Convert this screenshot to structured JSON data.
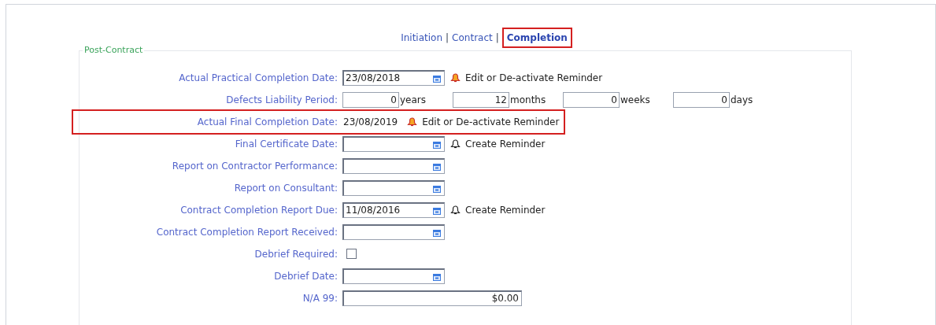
{
  "tabs": [
    {
      "label": "Initiation",
      "selected": false
    },
    {
      "label": "Contract",
      "selected": false
    },
    {
      "label": "Completion",
      "selected": true
    }
  ],
  "tab_separators": [
    "|",
    "|"
  ],
  "section": {
    "title": "Post-Contract",
    "rows": [
      {
        "kind": "date",
        "label": "Actual Practical Completion Date:",
        "value": "23/08/2018",
        "highlighted": false,
        "reminder": {
          "active": true,
          "text": "Edit or De-activate Reminder"
        }
      },
      {
        "kind": "period",
        "label": "Defects Liability Period:",
        "highlighted": false,
        "parts": [
          {
            "value": "0",
            "unit": "years"
          },
          {
            "value": "12",
            "unit": "months"
          },
          {
            "value": "0",
            "unit": "weeks"
          },
          {
            "value": "0",
            "unit": "days"
          }
        ]
      },
      {
        "kind": "text",
        "label": "Actual Final Completion Date:",
        "value": "23/08/2019",
        "highlighted": true,
        "reminder": {
          "active": true,
          "text": "Edit or De-activate Reminder"
        }
      },
      {
        "kind": "date",
        "label": "Final Certificate Date:",
        "highlighted": false,
        "reminder": {
          "active": false,
          "text": "Create Reminder"
        }
      },
      {
        "kind": "date",
        "label": "Report on Contractor Performance:",
        "highlighted": false
      },
      {
        "kind": "date",
        "label": "Report on Consultant:",
        "highlighted": false
      },
      {
        "kind": "date",
        "label": "Contract Completion Report Due:",
        "value": "11/08/2016",
        "highlighted": false,
        "reminder": {
          "active": false,
          "text": "Create Reminder"
        }
      },
      {
        "kind": "date",
        "label": "Contract Completion Report Received:",
        "highlighted": false
      },
      {
        "kind": "checkbox",
        "label": "Debrief Required:",
        "checked": false,
        "highlighted": false
      },
      {
        "kind": "date",
        "label": "Debrief Date:",
        "highlighted": false
      },
      {
        "kind": "money",
        "label": "N/A 99:",
        "value": "$0.00",
        "highlighted": false
      }
    ]
  }
}
